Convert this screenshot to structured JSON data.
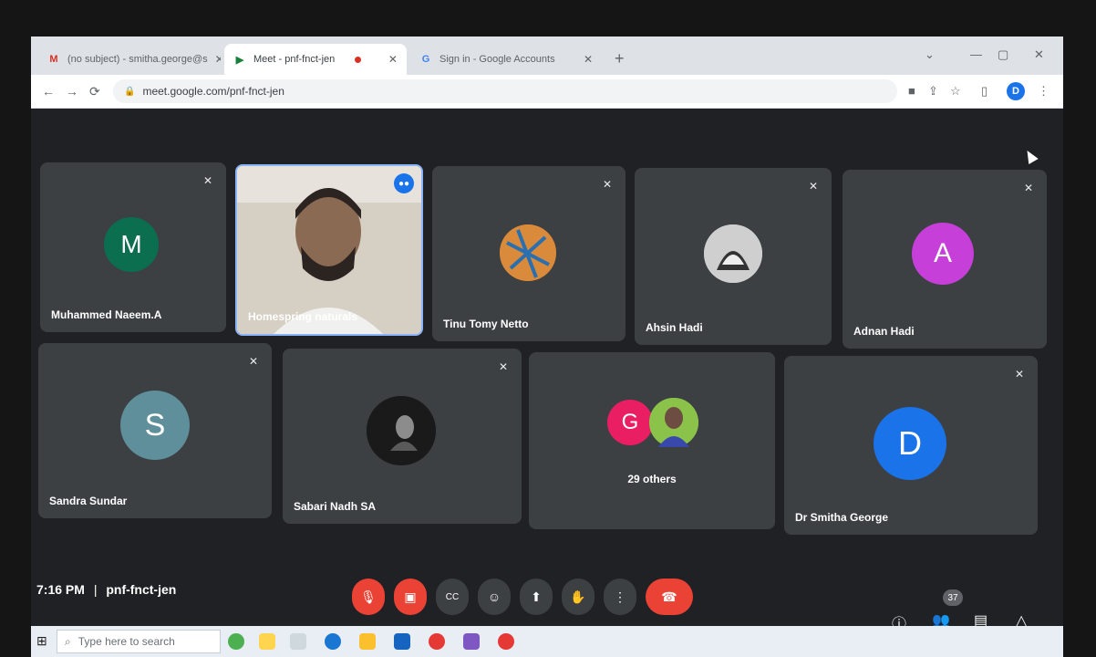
{
  "browser": {
    "tabs": [
      {
        "label": "(no subject) - smitha.george@s",
        "icon": "gmail-icon",
        "color": "#d93025"
      },
      {
        "label": "Meet - pnf-fnct-jen",
        "icon": "meet-icon",
        "color": "#188038"
      },
      {
        "label": "Sign in - Google Accounts",
        "icon": "google-icon",
        "color": "#4285f4"
      }
    ],
    "new_tab": "+",
    "url": "meet.google.com/pnf-fnct-jen",
    "profile_initial": "D"
  },
  "participants": [
    {
      "name": "Muhammed Naeem.A",
      "initial": "M",
      "color": "#0b6e4f"
    },
    {
      "name": "Homespring naturals",
      "video": true
    },
    {
      "name": "Tinu Tomy Netto",
      "avatar": "photo"
    },
    {
      "name": "Ahsin Hadi",
      "avatar": "photo"
    },
    {
      "name": "Adnan Hadi",
      "initial": "A",
      "color": "#c53fd8"
    },
    {
      "name": "Sandra Sundar",
      "initial": "S",
      "color": "#5f8f9b"
    },
    {
      "name": "Sabari Nadh SA",
      "avatar": "photo"
    },
    {
      "others_label": "29 others",
      "initial": "G",
      "color": "#e91e63"
    },
    {
      "name": "Dr Smitha George",
      "initial": "D",
      "color": "#1a73e8"
    }
  ],
  "meeting": {
    "time": "7:16 PM",
    "separator": "|",
    "code": "pnf-fnct-jen",
    "participant_count": "37"
  },
  "taskbar": {
    "search_placeholder": "Type here to search"
  },
  "colors": {
    "background": "#202124",
    "tile": "#3c4043",
    "end_call": "#ea4335",
    "accent": "#1a73e8"
  }
}
